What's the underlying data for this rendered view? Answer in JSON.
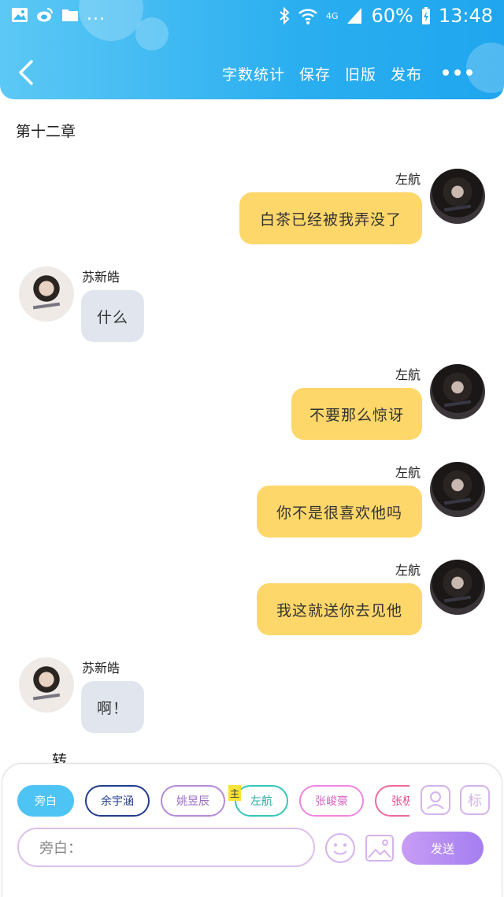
{
  "status_bar": {
    "battery_percent": "60%",
    "time": "13:48",
    "network": "4G",
    "notifications_more": "..."
  },
  "nav": {
    "actions": [
      "字数统计",
      "保存",
      "旧版",
      "发布"
    ]
  },
  "chapter_title": "第十二章",
  "messages": [
    {
      "side": "right",
      "speaker": "左航",
      "text": "白茶已经被我弄没了"
    },
    {
      "side": "left",
      "speaker": "苏新皓",
      "text": "什么"
    },
    {
      "side": "right",
      "speaker": "左航",
      "text": "不要那么惊讶"
    },
    {
      "side": "right",
      "speaker": "左航",
      "text": "你不是很喜欢他吗"
    },
    {
      "side": "right",
      "speaker": "左航",
      "text": "我这就送你去见他"
    },
    {
      "side": "left",
      "speaker": "苏新皓",
      "text": "啊！"
    }
  ],
  "partial_text": "转",
  "characters": [
    {
      "label": "旁白",
      "active": true,
      "color": "#4ec4f4"
    },
    {
      "label": "余宇涵",
      "active": false,
      "color": "#223d8c"
    },
    {
      "label": "姚昱辰",
      "active": false,
      "color": "#b68ad9"
    },
    {
      "label": "左航",
      "active": false,
      "color": "#35c6bd"
    },
    {
      "label": "张峻豪",
      "active": false,
      "color": "#ef86e0"
    },
    {
      "label": "张极",
      "active": false,
      "color": "#f06aa0"
    }
  ],
  "main_role_tag": "主",
  "mark_button_label": "标",
  "input": {
    "placeholder": "旁白："
  },
  "send_label": "发送",
  "colors": {
    "header": "#2aaef0",
    "right_bubble": "#fdd76a",
    "left_bubble": "#e1e6ee",
    "send": "#b08af2"
  }
}
